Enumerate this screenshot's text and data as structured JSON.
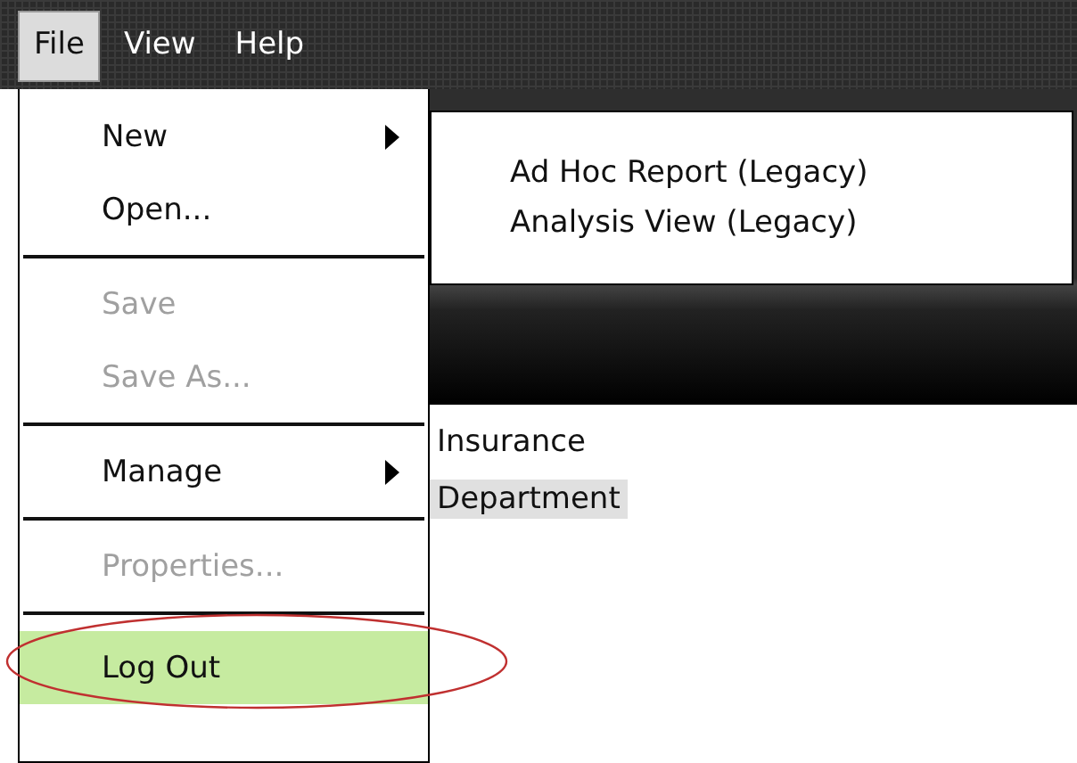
{
  "menubar": [
    {
      "label": "File",
      "selected": true
    },
    {
      "label": "View",
      "selected": false
    },
    {
      "label": "Help",
      "selected": false
    }
  ],
  "file_menu": [
    {
      "kind": "item",
      "label": "New",
      "submenu": true,
      "disabled": false,
      "selected": false,
      "annotated": false
    },
    {
      "kind": "item",
      "label": "Open...",
      "submenu": false,
      "disabled": false,
      "selected": false,
      "annotated": false
    },
    {
      "kind": "separator"
    },
    {
      "kind": "item",
      "label": "Save",
      "submenu": false,
      "disabled": true,
      "selected": false,
      "annotated": false
    },
    {
      "kind": "item",
      "label": "Save As...",
      "submenu": false,
      "disabled": true,
      "selected": false,
      "annotated": false
    },
    {
      "kind": "separator"
    },
    {
      "kind": "item",
      "label": "Manage",
      "submenu": true,
      "disabled": false,
      "selected": false,
      "annotated": false
    },
    {
      "kind": "separator"
    },
    {
      "kind": "item",
      "label": "Properties...",
      "submenu": false,
      "disabled": true,
      "selected": false,
      "annotated": false
    },
    {
      "kind": "separator"
    },
    {
      "kind": "item",
      "label": "Log Out",
      "submenu": false,
      "disabled": false,
      "selected": true,
      "annotated": true
    }
  ],
  "new_submenu": [
    {
      "label": "Ad Hoc Report (Legacy)"
    },
    {
      "label": "Analysis View (Legacy)"
    }
  ],
  "content_list": [
    {
      "label": "Insurance",
      "selected": false
    },
    {
      "label": "Department",
      "selected": true
    }
  ]
}
